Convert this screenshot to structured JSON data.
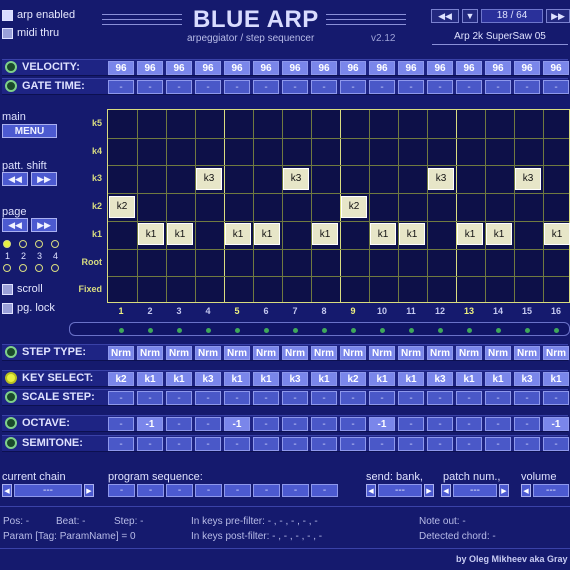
{
  "header": {
    "arp_enabled": "arp enabled",
    "midi_thru": "midi thru",
    "title": "BLUE ARP",
    "subtitle": "arpeggiator / step sequencer",
    "version": "v2.12",
    "preset_counter": "18 / 64",
    "preset_name": "Arp 2k SuperSaw 05"
  },
  "rows": {
    "velocity": {
      "label": "VELOCITY:",
      "values": [
        "96",
        "96",
        "96",
        "96",
        "96",
        "96",
        "96",
        "96",
        "96",
        "96",
        "96",
        "96",
        "96",
        "96",
        "96",
        "96"
      ]
    },
    "gate_time": {
      "label": "GATE TIME:",
      "values": [
        "-",
        "-",
        "-",
        "-",
        "-",
        "-",
        "-",
        "-",
        "-",
        "-",
        "-",
        "-",
        "-",
        "-",
        "-",
        "-"
      ]
    },
    "step_type": {
      "label": "STEP TYPE:",
      "values": [
        "Nrm",
        "Nrm",
        "Nrm",
        "Nrm",
        "Nrm",
        "Nrm",
        "Nrm",
        "Nrm",
        "Nrm",
        "Nrm",
        "Nrm",
        "Nrm",
        "Nrm",
        "Nrm",
        "Nrm",
        "Nrm"
      ]
    },
    "key_select": {
      "label": "KEY SELECT:",
      "values": [
        "k2",
        "k1",
        "k1",
        "k3",
        "k1",
        "k1",
        "k3",
        "k1",
        "k2",
        "k1",
        "k1",
        "k3",
        "k1",
        "k1",
        "k3",
        "k1"
      ]
    },
    "scale_step": {
      "label": "SCALE STEP:",
      "values": [
        "-",
        "-",
        "-",
        "-",
        "-",
        "-",
        "-",
        "-",
        "-",
        "-",
        "-",
        "-",
        "-",
        "-",
        "-",
        "-"
      ]
    },
    "octave": {
      "label": "OCTAVE:",
      "values": [
        "-",
        "-1",
        "-",
        "-",
        "-1",
        "-",
        "-",
        "-",
        "-",
        "-1",
        "-",
        "-",
        "-",
        "-",
        "-",
        "-1"
      ]
    },
    "semitone": {
      "label": "SEMITONE:",
      "values": [
        "-",
        "-",
        "-",
        "-",
        "-",
        "-",
        "-",
        "-",
        "-",
        "-",
        "-",
        "-",
        "-",
        "-",
        "-",
        "-"
      ]
    }
  },
  "left_panel": {
    "main_label": "main",
    "menu_button": "MENU",
    "patt_shift_label": "patt. shift",
    "page_label": "page",
    "back_arrows": "◀◀",
    "fwd_arrows": "▶▶",
    "page_numbers": [
      "1",
      "2",
      "3",
      "4"
    ],
    "scroll": "scroll",
    "pg_lock": "pg. lock"
  },
  "grid": {
    "row_names": [
      "k5",
      "k4",
      "k3",
      "k2",
      "k1",
      "Root",
      "Fixed"
    ],
    "step_numbers": [
      "1",
      "2",
      "3",
      "4",
      "5",
      "6",
      "7",
      "8",
      "9",
      "10",
      "11",
      "12",
      "13",
      "14",
      "15",
      "16"
    ],
    "notes": [
      {
        "step": 1,
        "row": "k2",
        "label": "k2"
      },
      {
        "step": 2,
        "row": "k1",
        "label": "k1"
      },
      {
        "step": 3,
        "row": "k1",
        "label": "k1"
      },
      {
        "step": 4,
        "row": "k3",
        "label": "k3"
      },
      {
        "step": 5,
        "row": "k1",
        "label": "k1"
      },
      {
        "step": 6,
        "row": "k1",
        "label": "k1"
      },
      {
        "step": 7,
        "row": "k3",
        "label": "k3"
      },
      {
        "step": 8,
        "row": "k1",
        "label": "k1"
      },
      {
        "step": 9,
        "row": "k2",
        "label": "k2"
      },
      {
        "step": 10,
        "row": "k1",
        "label": "k1"
      },
      {
        "step": 11,
        "row": "k1",
        "label": "k1"
      },
      {
        "step": 12,
        "row": "k3",
        "label": "k3"
      },
      {
        "step": 13,
        "row": "k1",
        "label": "k1"
      },
      {
        "step": 14,
        "row": "k1",
        "label": "k1"
      },
      {
        "step": 15,
        "row": "k3",
        "label": "k3"
      },
      {
        "step": 16,
        "row": "k1",
        "label": "k1"
      }
    ]
  },
  "bottom": {
    "current_chain": "current chain",
    "program_sequence": "program sequence:",
    "send_bank": "send: bank,",
    "patch_num": "patch num.,",
    "volume": "volume",
    "chain_value": "---",
    "bank_value": "---",
    "patch_value": "---",
    "volume_value": "---",
    "sequence": [
      "-",
      "-",
      "-",
      "-",
      "-",
      "-",
      "-",
      "-"
    ]
  },
  "status": {
    "pos": "Pos:  -",
    "beat": "Beat:  -",
    "step": "Step:  -",
    "keys_pre": "In keys pre-filter:   - ,  - ,  - ,  - ,  -",
    "keys_post": "In keys post-filter:   - ,  - ,  - ,  - ,  -",
    "note_out": "Note out:    -",
    "param": "Param [Tag: ParamName] = 0",
    "detected_chord": "Detected chord:    -",
    "author": "by Oleg Mikheev aka Gray"
  },
  "colors": {
    "background": "#151a6e",
    "cell": "#5b68d8",
    "grid_line": "#d8dc80",
    "note": "#e7e6c8",
    "led_on": "#e8f040"
  }
}
